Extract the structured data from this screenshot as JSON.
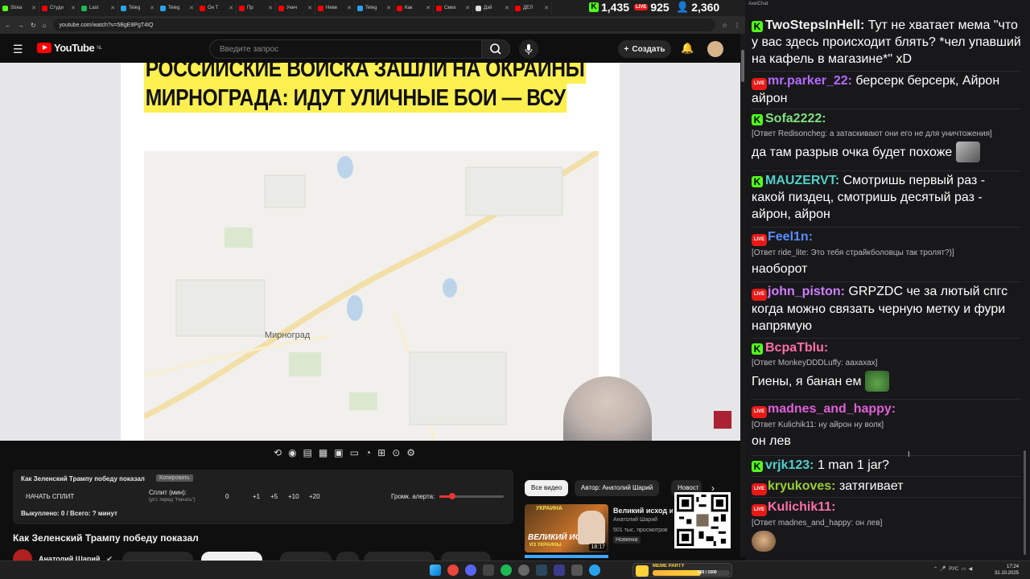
{
  "browser": {
    "tabs": [
      "Strea",
      "Студи",
      "Last",
      "Teleg",
      "Teleg",
      "Он Т",
      "Пр",
      "Унич",
      "Неве",
      "Teleg",
      "Как",
      "Смех",
      "Дэй",
      "ДЕЛ"
    ],
    "stats": {
      "kick_viewers": "1,435",
      "live_viewers": "925",
      "total_viewers": "2,360"
    },
    "url": "youtube.com/watch?v=5BgE8PgT4IQ"
  },
  "youtube": {
    "logo_text": "YouTube",
    "logo_region": "NL",
    "search_placeholder": "Введите запрос",
    "create_label": "Создать",
    "headline_lines": [
      "РОССИЙСКИЕ ВОЙСКА ЗАШЛИ НА ОКРАИНЫ",
      "МИРНОГРАДА: ИДУТ УЛИЧНЫЕ БОИ — ВСУ"
    ],
    "map_city_label": "Мирноград",
    "panel": {
      "title": "Как Зеленский Трампу победу показал",
      "copy_chip": "Копировать",
      "start_split": "НАЧАТЬ СПЛИТ",
      "split_label": "Сплит (мин):",
      "split_hint": "(уст. перед \"Начать\")",
      "values": [
        "0",
        "+1",
        "+5",
        "+10",
        "+20"
      ],
      "volume_label": "Громк. алерта:",
      "volume_level": 0.2,
      "summary": "Выкуплено: 0 / Всего: ? минут"
    },
    "video_title": "Как Зеленский Трампу победу показал",
    "channel_name": "Анатолий Шарий",
    "chips": [
      "Все видео",
      "Автор: Анатолий Шарий",
      "Новост"
    ],
    "recommendation": {
      "title": "Великий исход из",
      "channel": "Анатолий Шарий",
      "views": "501 тыс. просмотров",
      "badge": "Новинка",
      "duration": "18:17",
      "thumb_top": "УКРАИНА",
      "thumb_main": "ВЕЛИКИЙ ИСХОД",
      "thumb_sub": "ИЗ УКРАИНЫ"
    }
  },
  "chat": {
    "title": "AxelChat",
    "messages": [
      {
        "platform": "kick",
        "nick": "TwoStepsInHell",
        "color": "#f1f1f1",
        "text": "Тут не хватает мема \"что у вас здесь происходит блять? *чел упавший на кафель в магазине*\" xD",
        "reply": ""
      },
      {
        "platform": "live",
        "nick": "mr.parker_22",
        "color": "#b36bff",
        "text": "берсерк берсерк, Айрон айрон",
        "reply": ""
      },
      {
        "platform": "kick",
        "nick": "Sofa2222",
        "color": "#7fe07f",
        "text": "да там разрыв очка будет похоже",
        "reply": "[Ответ Redisoncheg: а затаскивают они его не для уничтожения]"
      },
      {
        "platform": "kick",
        "nick": "MAUZERVT",
        "color": "#4fd0c8",
        "text": "Смотришь первый раз - какой пиздец, смотришь десятый раз - айрон, айрон",
        "reply": ""
      },
      {
        "platform": "live",
        "nick": "Feel1n",
        "color": "#5a8cff",
        "text": "наоборот",
        "reply": "[Ответ ride_lite: Это тебя страйкболовцы так тролят?)]"
      },
      {
        "platform": "live",
        "nick": "john_piston",
        "color": "#d07fff",
        "text": "GRPZDC че за лютый спгс когда можно связать черную метку и фури напрямую",
        "reply": ""
      },
      {
        "platform": "kick",
        "nick": "ВсраТblu",
        "color": "#ff6fa8",
        "text": "Гиены, я банан ем",
        "reply": "[Ответ MonkeyDDDLuffy: аахахах]"
      },
      {
        "platform": "live",
        "nick": "madnes_and_happy",
        "color": "#e05fd8",
        "text": "он лев",
        "reply": "[Ответ Kulichik11: ну айрон ну волк]"
      },
      {
        "platform": "kick",
        "nick": "vrjk123",
        "color": "#4fd0c8",
        "text": "1 man 1 jar?",
        "reply": ""
      },
      {
        "platform": "live",
        "nick": "kryukoves",
        "color": "#9acd32",
        "text": "затягивает",
        "reply": ""
      },
      {
        "platform": "live",
        "nick": "Kulichik11",
        "color": "#ff6fa8",
        "text": "",
        "reply": "[Ответ madnes_and_happy: он лев]"
      }
    ]
  },
  "taskbar": {
    "meme_party_label": "MEME PARTY",
    "meme_party_progress": "950 / 1500",
    "language": "РУС",
    "time": "17:24",
    "date": "31.10.2025"
  },
  "colors": {
    "kick": "#53fc18",
    "live": "#e91916",
    "highlight": "#fcef50",
    "youtube_red": "#ff0000"
  }
}
